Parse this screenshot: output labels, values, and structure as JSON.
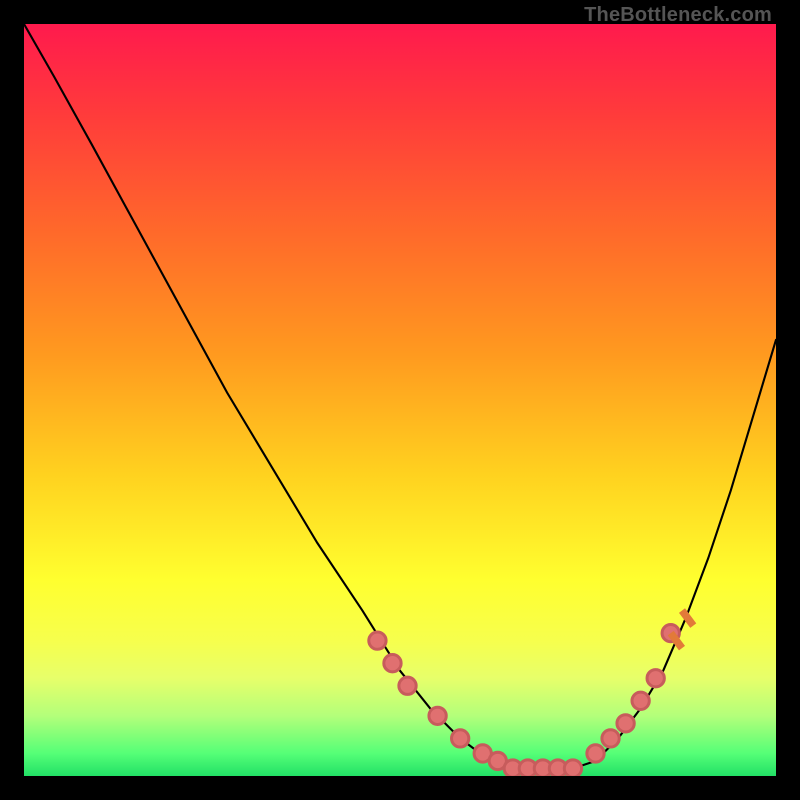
{
  "watermark": "TheBottleneck.com",
  "chart_data": {
    "type": "line",
    "title": "",
    "xlabel": "",
    "ylabel": "",
    "xlim": [
      0,
      100
    ],
    "ylim": [
      0,
      100
    ],
    "series": [
      {
        "name": "curve",
        "x": [
          0,
          4,
          9,
          15,
          21,
          27,
          33,
          39,
          45,
          50,
          54,
          58,
          62,
          66,
          70,
          73,
          76,
          79,
          82,
          85,
          88,
          91,
          94,
          97,
          100
        ],
        "values": [
          100,
          93,
          84,
          73,
          62,
          51,
          41,
          31,
          22,
          14,
          9,
          5,
          2,
          1,
          1,
          1,
          2,
          5,
          9,
          14,
          21,
          29,
          38,
          48,
          58
        ]
      }
    ],
    "markers": {
      "name": "highlight-dots",
      "x": [
        47,
        49,
        51,
        55,
        58,
        61,
        63,
        65,
        67,
        69,
        71,
        73,
        76,
        78,
        80,
        82,
        84,
        86
      ],
      "values": [
        18,
        15,
        12,
        8,
        5,
        3,
        2,
        1,
        1,
        1,
        1,
        1,
        3,
        5,
        7,
        10,
        13,
        19
      ]
    }
  }
}
